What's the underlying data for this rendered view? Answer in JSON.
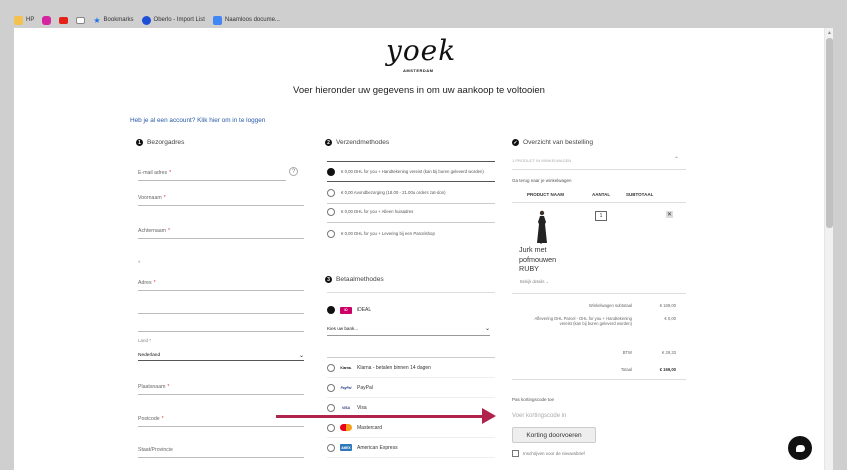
{
  "bookmarks": [
    {
      "label": "HP",
      "icon": "folder-icon",
      "color": "#f2c14e"
    },
    {
      "label": "",
      "icon": "instagram-icon",
      "color": "#d6249f"
    },
    {
      "label": "",
      "icon": "youtube-icon",
      "color": "#e62117"
    },
    {
      "label": "",
      "icon": "mail-icon",
      "color": "#888888"
    },
    {
      "label": "Bookmarks",
      "icon": "star-icon",
      "color": "#1a73e8"
    },
    {
      "label": "Oberlo - Import List",
      "icon": "oberlo-icon",
      "color": "#1d4ed8"
    },
    {
      "label": "Naamloos docume...",
      "icon": "docs-icon",
      "color": "#4285f4"
    }
  ],
  "brand": {
    "logo": "yoek",
    "sub": "AMSTERDAM"
  },
  "headline": "Voer hieronder uw gegevens in om uw aankoop te voltooien",
  "login_link": "Heb je al een account? Klik hier om in te loggen",
  "billing": {
    "title": "Bezorgadres",
    "step": "1",
    "fields": {
      "email": "E-mail adres",
      "first": "Voornaam",
      "last": "Achternaam",
      "address": "Adres",
      "city": "Plaatsnaam",
      "zip": "Postcode",
      "state": "Staat/Provincie"
    },
    "required": "*",
    "help": "?",
    "extra": "*",
    "country_label": "Land *",
    "country_value": "Nederland"
  },
  "shipping": {
    "title": "Verzendmethodes",
    "step": "2",
    "options": [
      {
        "text": "€ 0,00   DHL for you + Handtekening vereist (kan bij buren geleverd worden)",
        "selected": true
      },
      {
        "text": "€ 0,00   Avondbezorging (18.00 - 21.00u orders zat-don)",
        "selected": false
      },
      {
        "text": "€ 0,00   DHL for you + Alleen huisadres",
        "selected": false
      },
      {
        "text": "€ 0,00   DHL for you + Levering bij een Parcelshop",
        "selected": false
      }
    ]
  },
  "payment": {
    "title": "Betaalmethodes",
    "step": "3",
    "ideal": "iDEAL",
    "bank_placeholder": "Kies uw bank...",
    "methods": [
      {
        "label": "Klarna - betalen binnen 14 dagen",
        "logo": "Klarna.",
        "color": "#ffb3c7"
      },
      {
        "label": "PayPal",
        "logo": "PayPal",
        "color": "#ffffff"
      },
      {
        "label": "Visa",
        "logo": "VISA",
        "color": "#ffffff"
      },
      {
        "label": "Mastercard",
        "logo": "MC",
        "color": "#ffffff"
      },
      {
        "label": "American Express",
        "logo": "AMEX",
        "color": "#2e77bb"
      }
    ]
  },
  "order": {
    "title": "Overzicht van bestelling",
    "count": "1 PRODUCT IN WINKELWAGEN",
    "back": "Ga terug naar je winkelwagen",
    "headers": {
      "product": "PRODUCT NAAM",
      "qty": "AANTAL",
      "subtotal": "SUBTOTAAL"
    },
    "product": {
      "name": "Jurk met pofmouwen RUBY",
      "qty": "1",
      "details": "Bekijk details"
    },
    "summary": [
      {
        "label": "Winkelwagen subtotaal",
        "value": "€ 169,00"
      },
      {
        "label": "Aflevering DHL Parcel - DHL for you + Handtekening vereist (kan bij buren geleverd worden)",
        "value": "€ 0,00"
      },
      {
        "label": "BTW",
        "value": "€ 29,33"
      },
      {
        "label": "Totaal",
        "value": "€ 169,00"
      }
    ],
    "coupon_label": "Pas kortingscode toe",
    "coupon_placeholder": "Voer kortingscode in",
    "coupon_button": "Korting doorvoeren",
    "newsletter": "Inschrijven voor de nieuwsbrief"
  }
}
